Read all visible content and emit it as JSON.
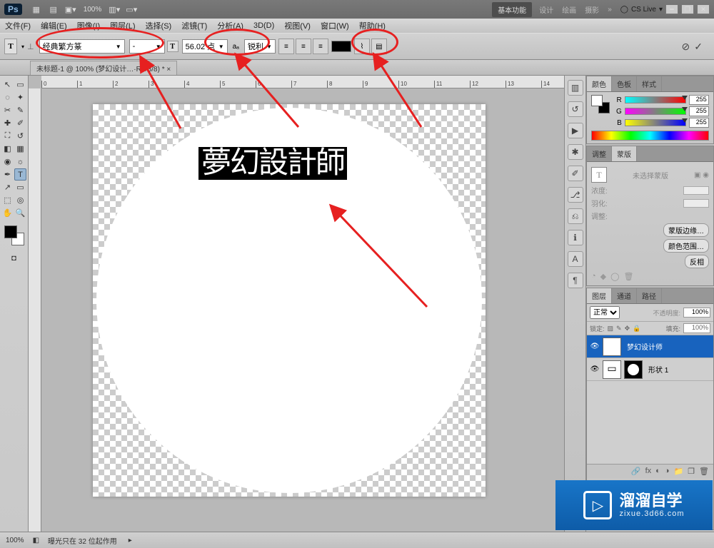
{
  "title_bar": {
    "app": "Ps",
    "zoom": "100%",
    "essentials": "基本功能",
    "workspaces": [
      "设计",
      "绘画",
      "摄影"
    ],
    "cs_live": "CS Live"
  },
  "menu": [
    "文件(F)",
    "编辑(E)",
    "图像(I)",
    "图层(L)",
    "选择(S)",
    "滤镜(T)",
    "分析(A)",
    "3D(D)",
    "视图(V)",
    "窗口(W)",
    "帮助(H)"
  ],
  "options": {
    "font_family": "经典繁方篆",
    "font_style": "-",
    "font_size": "56.02 点",
    "aa_label": "aₐ",
    "aa_value": "锐利",
    "color": "#000000"
  },
  "doc_tab": "未标题-1 @ 100% (梦幻设计…·RGB/8) * ×",
  "canvas_text": "夢幻設計師",
  "color_panel": {
    "tabs": [
      "颜色",
      "色板",
      "样式"
    ],
    "r": 255,
    "g": 255,
    "b": 255
  },
  "mask_panel": {
    "tabs": [
      "调整",
      "蒙版"
    ],
    "no_sel": "未选择蒙版",
    "density": "浓度:",
    "feather": "羽化:",
    "refine": "调整:",
    "btn_edge": "蒙版边缘…",
    "btn_range": "颜色范围…",
    "btn_invert": "反相"
  },
  "layers_panel": {
    "tabs": [
      "图层",
      "通道",
      "路径"
    ],
    "blend": "正常",
    "opacity_label": "不透明度:",
    "opacity": "100%",
    "lock_label": "锁定:",
    "fill_label": "填充:",
    "fill": "100%",
    "layers": [
      {
        "name": "梦幻设计师",
        "type": "T",
        "selected": true
      },
      {
        "name": "形状 1",
        "type": "shape",
        "selected": false
      }
    ]
  },
  "status": {
    "zoom": "100%",
    "hint": "曝光只在 32 位起作用"
  },
  "watermark": {
    "big": "溜溜自学",
    "small": "zixue.3d66.com"
  }
}
